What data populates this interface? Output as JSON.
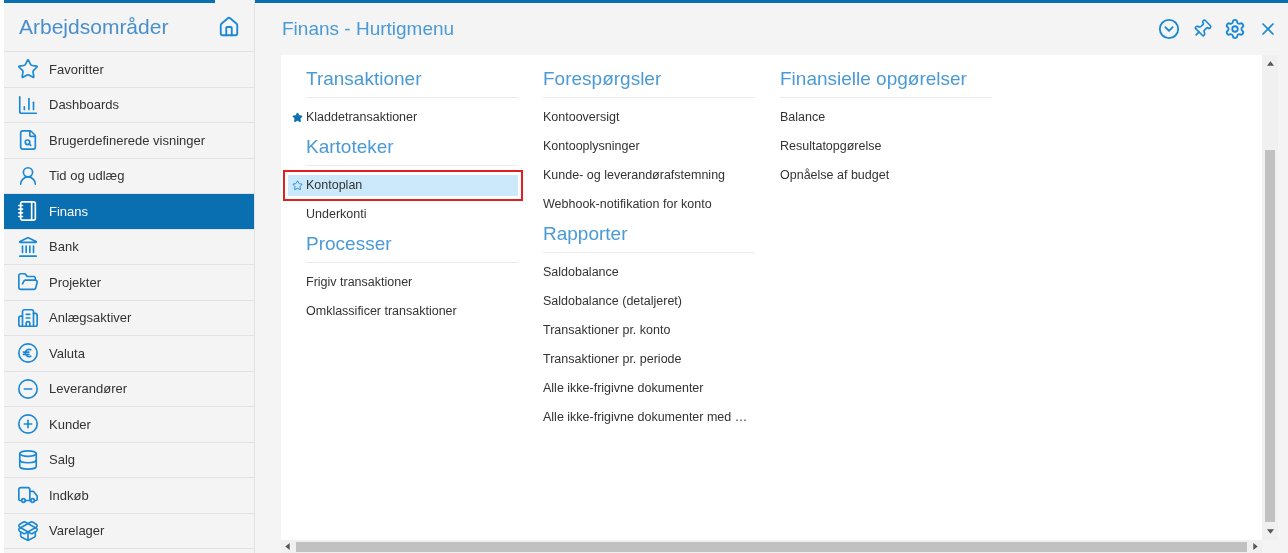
{
  "sidebar": {
    "title": "Arbejdsområder",
    "items": [
      {
        "label": "Favoritter",
        "selected": false
      },
      {
        "label": "Dashboards",
        "selected": false
      },
      {
        "label": "Brugerdefinerede visninger",
        "selected": false
      },
      {
        "label": "Tid og udlæg",
        "selected": false
      },
      {
        "label": "Finans",
        "selected": true
      },
      {
        "label": "Bank",
        "selected": false
      },
      {
        "label": "Projekter",
        "selected": false
      },
      {
        "label": "Anlægsaktiver",
        "selected": false
      },
      {
        "label": "Valuta",
        "selected": false
      },
      {
        "label": "Leverandører",
        "selected": false
      },
      {
        "label": "Kunder",
        "selected": false
      },
      {
        "label": "Salg",
        "selected": false
      },
      {
        "label": "Indkøb",
        "selected": false
      },
      {
        "label": "Varelager",
        "selected": false
      }
    ]
  },
  "header": {
    "title": "Finans - Hurtigmenu"
  },
  "columns": [
    {
      "sections": [
        {
          "heading": "Transaktioner",
          "items": [
            {
              "label": "Kladdetransaktioner",
              "favorite": true,
              "selected": false
            }
          ]
        },
        {
          "heading": "Kartoteker",
          "items": [
            {
              "label": "Kontoplan",
              "favorite": false,
              "selected": true
            },
            {
              "label": "Underkonti",
              "selected": false
            }
          ]
        },
        {
          "heading": "Processer",
          "items": [
            {
              "label": "Frigiv transaktioner",
              "selected": false
            },
            {
              "label": "Omklassificer transaktioner",
              "selected": false
            }
          ]
        }
      ]
    },
    {
      "sections": [
        {
          "heading": "Forespørgsler",
          "items": [
            {
              "label": "Kontooversigt",
              "selected": false
            },
            {
              "label": "Kontooplysninger",
              "selected": false
            },
            {
              "label": "Kunde- og leverandørafstemning",
              "selected": false
            },
            {
              "label": "Webhook-notifikation for konto",
              "selected": false
            }
          ]
        },
        {
          "heading": "Rapporter",
          "items": [
            {
              "label": "Saldobalance",
              "selected": false
            },
            {
              "label": "Saldobalance (detaljeret)",
              "selected": false
            },
            {
              "label": "Transaktioner pr. konto",
              "selected": false
            },
            {
              "label": "Transaktioner pr. periode",
              "selected": false
            },
            {
              "label": "Alle ikke-frigivne dokumenter",
              "selected": false
            },
            {
              "label": "Alle ikke-frigivne dokumenter med …",
              "selected": false
            }
          ]
        }
      ]
    },
    {
      "sections": [
        {
          "heading": "Finansielle opgørelser",
          "items": [
            {
              "label": "Balance",
              "selected": false
            },
            {
              "label": "Resultatopgørelse",
              "selected": false
            },
            {
              "label": "Opnåelse af budget",
              "selected": false
            }
          ]
        }
      ]
    }
  ]
}
